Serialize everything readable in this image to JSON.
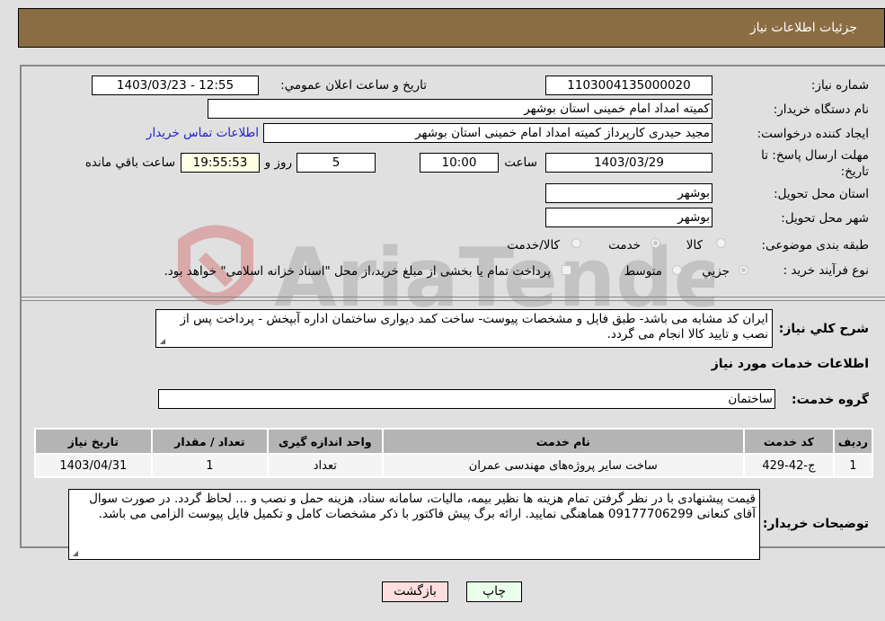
{
  "header": {
    "title": "جزئیات اطلاعات نیاز"
  },
  "form": {
    "need_number": {
      "label": "شماره نیاز:",
      "value": "1103004135000020"
    },
    "announce_datetime": {
      "label": "تاریخ و ساعت اعلان عمومي:",
      "value": "1403/03/23 - 12:55"
    },
    "buyer_org": {
      "label": "نام دستگاه خريدار:",
      "value": "کمیته امداد امام خمینی استان بوشهر"
    },
    "requester": {
      "label": "ایجاد کننده درخواست:",
      "value": "مجید حیدری کارپرداز کمیته امداد امام خمینی استان بوشهر"
    },
    "buyer_contact_link": "اطلاعات تماس خريدار",
    "deadline": {
      "label_line1": "مهلت ارسال پاسخ: تا",
      "label_line2": "تاریخ:",
      "date": "1403/03/29",
      "time_label": "ساعت",
      "time": "10:00",
      "days": "5",
      "days_label": "روز و",
      "remaining": "19:55:53",
      "remaining_label": "ساعت باقي مانده"
    },
    "province": {
      "label": "استان محل تحویل:",
      "value": "بوشهر"
    },
    "city": {
      "label": "شهر محل تحویل:",
      "value": "بوشهر"
    },
    "category": {
      "label": "طبقه بندی موضوعی:",
      "options": [
        "کالا",
        "خدمت",
        "کالا/خدمت"
      ],
      "selected": "خدمت"
    },
    "purchase_type": {
      "label": "نوع فرآیند خرید :",
      "options": [
        "جزيي",
        "متوسط"
      ],
      "selected": "جزيي",
      "treasury_checkbox_label": "پرداخت تمام یا بخشی از مبلغ خرید،از محل \"اسناد خزانه اسلامی\" خواهد بود.",
      "treasury_checked": false
    },
    "summary": {
      "label": "شرح کلي نياز:",
      "value": "ایران کد مشابه می باشد- طبق فایل و مشخصات پیوست- ساخت کمد دیواری ساختمان اداره آبپخش - پرداخت پس از نصب و تایید کالا انجام می گردد."
    }
  },
  "services": {
    "section_title": "اطلاعات خدمات مورد نياز",
    "group_label": "گروه خدمت:",
    "group_value": "ساختمان",
    "table": {
      "headers": [
        "ردیف",
        "کد خدمت",
        "نام خدمت",
        "واحد اندازه گیری",
        "تعداد / مقدار",
        "تاریخ نیاز"
      ],
      "rows": [
        [
          "1",
          "ج-42-429",
          "ساخت سایر پروژه‌های مهندسی عمران",
          "تعداد",
          "1",
          "1403/04/31"
        ]
      ]
    }
  },
  "buyer_notes": {
    "label": "توضیحات خریدار:",
    "value": "قیمت پیشنهادی با در نظر گرفتن تمام هزینه ها نظیر بیمه، مالیات، سامانه ستاد، هزینه حمل و نصب و ... لحاظ گردد. در صورت سوال آقای کنعانی 09177706299 هماهنگی نمایید. ارائه برگ پیش فاکتور با ذکر مشخصات کامل و تکمیل فایل پیوست الزامی می باشد."
  },
  "buttons": {
    "print": "چاپ",
    "back": "بازگشت"
  },
  "watermark": {
    "text": "AriaTender.neT"
  },
  "colors": {
    "header_bg": "#8b6d43",
    "print_bg": "#eaffea",
    "back_bg": "#ffdede",
    "link": "#2020d0"
  }
}
